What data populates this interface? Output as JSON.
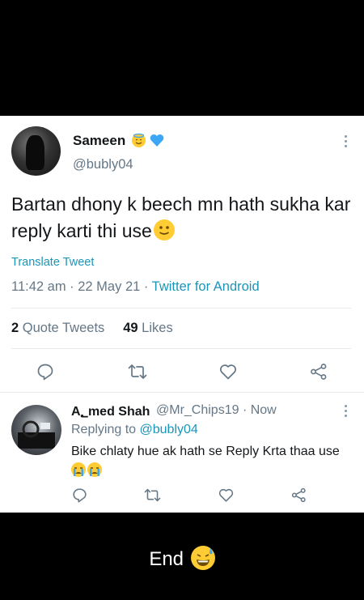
{
  "tweet": {
    "author_name": "Sameen",
    "author_handle": "@bubly04",
    "text": "Bartan dhony k beech mn hath sukha kar reply karti thi use",
    "translate_label": "Translate Tweet",
    "time": "11:42 am",
    "date": "22 May 21",
    "source": "Twitter for Android",
    "quote_count": "2",
    "quote_label": "Quote Tweets",
    "like_count": "49",
    "like_label": "Likes"
  },
  "reply": {
    "author_name": "A؂med Shah",
    "author_handle": "@Mr_Chips19",
    "time": "Now",
    "replying_prefix": "Replying to",
    "replying_to": "@bubly04",
    "text": "Bike chlaty hue ak hath se Reply Krta thaa use"
  },
  "footer": {
    "text": "End"
  },
  "colors": {
    "link": "#1b95b8",
    "muted": "#657786",
    "icon": "#657786",
    "emoji": "#ffcc33",
    "heart_blue": "#3ea7f5"
  },
  "icons": [
    "halo-smile-emoji",
    "blue-heart-emoji",
    "slight-smile-emoji",
    "more-options-icon",
    "reply-icon",
    "retweet-icon",
    "like-icon",
    "share-icon",
    "crying-emoji",
    "sweat-smile-emoji"
  ]
}
